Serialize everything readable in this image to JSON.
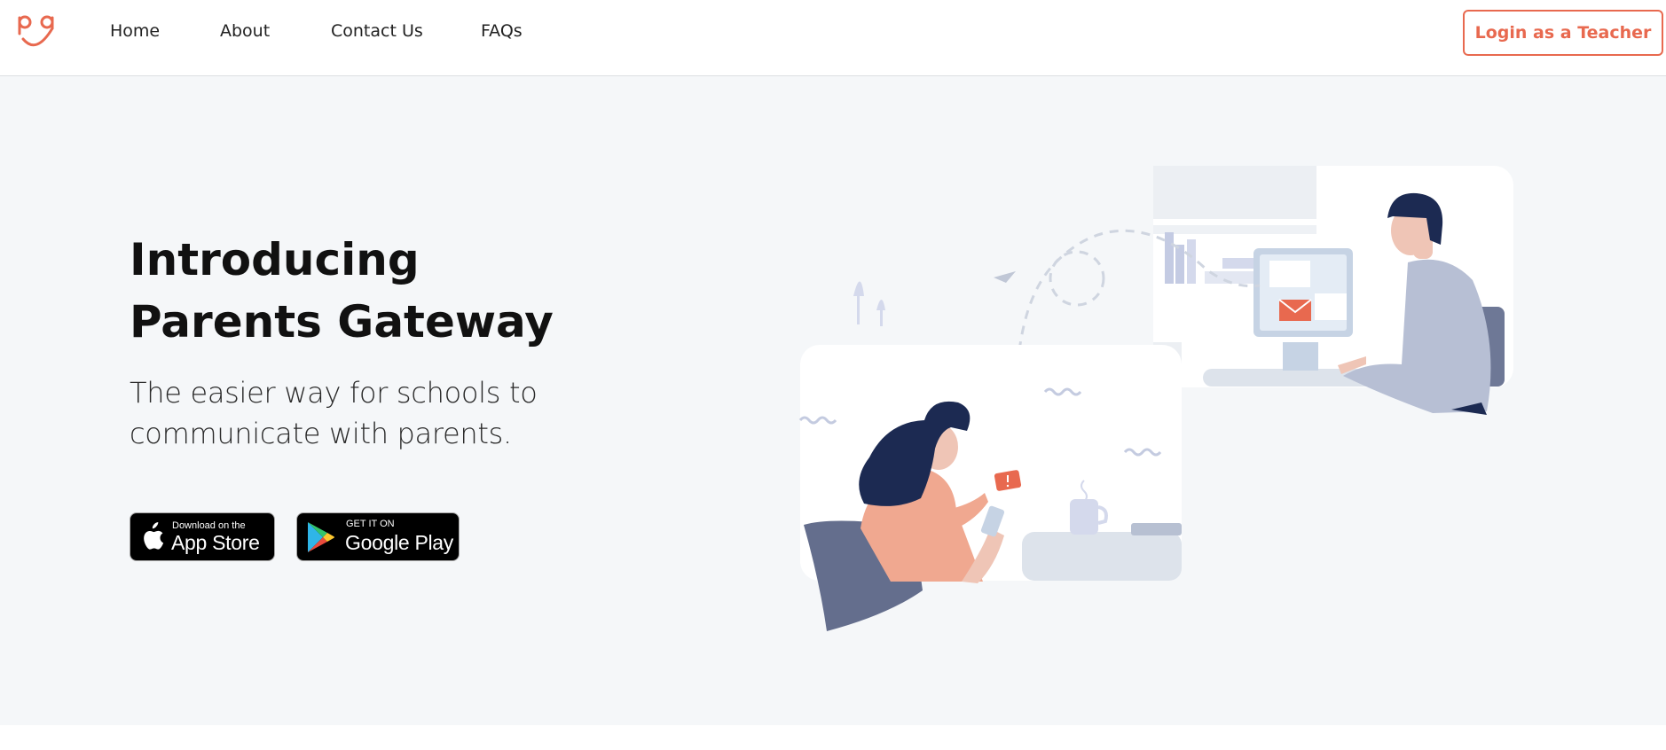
{
  "header": {
    "logo_text": "pg",
    "nav": {
      "home": "Home",
      "about": "About",
      "contact": "Contact Us",
      "faqs": "FAQs"
    },
    "login_label": "Login as a Teacher"
  },
  "hero": {
    "title_line1": "Introducing",
    "title_line2": "Parents Gateway",
    "subtitle_line1": "The easier way for schools to",
    "subtitle_line2": "communicate with parents."
  },
  "badges": {
    "apple_small": "Download on the",
    "apple_big": "App Store",
    "google_small": "GET IT ON",
    "google_big": "Google Play"
  },
  "colors": {
    "accent": "#e8694f",
    "hero_bg": "#f5f7f9",
    "navy": "#1a2a52"
  },
  "icons": [
    "pg-logo-icon",
    "apple-icon",
    "google-play-icon",
    "envelope-icon",
    "alert-icon"
  ]
}
